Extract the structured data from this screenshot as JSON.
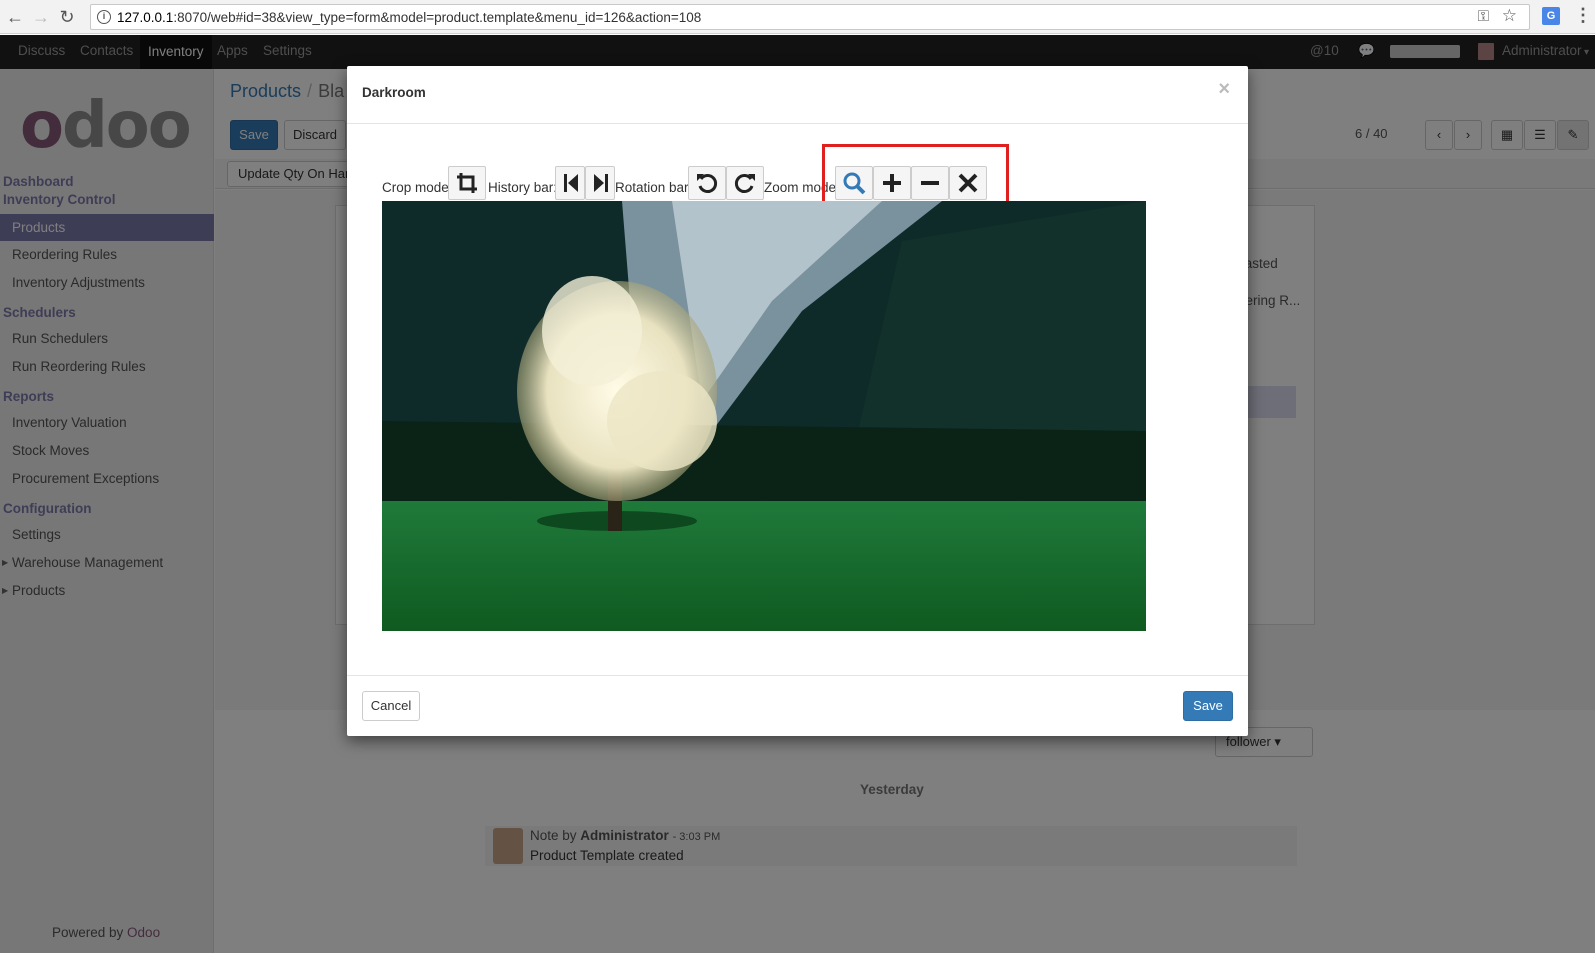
{
  "browser": {
    "url_host": "127.0.0.1",
    "url_rest": ":8070/web#id=38&view_type=form&model=product.template&menu_id=126&action=108"
  },
  "topbar": {
    "apps": [
      "Discuss",
      "Contacts",
      "Inventory",
      "Apps",
      "Settings"
    ],
    "active_app": "Inventory",
    "mentions": "@10",
    "user": "Administrator"
  },
  "sidebar": {
    "sections": [
      {
        "label": "Dashboard"
      },
      {
        "label": "Inventory Control",
        "items": [
          "Products",
          "Reordering Rules",
          "Inventory Adjustments"
        ]
      },
      {
        "label": "Schedulers",
        "items": [
          "Run Schedulers",
          "Run Reordering Rules"
        ]
      },
      {
        "label": "Reports",
        "items": [
          "Inventory Valuation",
          "Stock Moves",
          "Procurement Exceptions"
        ]
      },
      {
        "label": "Configuration",
        "items": [
          "Settings",
          "Warehouse Management",
          "Products"
        ]
      }
    ],
    "powered_prefix": "Powered by ",
    "powered_brand": "Odoo"
  },
  "main": {
    "breadcrumb_root": "Products",
    "breadcrumb_current": "Bla",
    "save": "Save",
    "discard": "Discard",
    "pager": "6 / 40",
    "update_qty": "Update Qty On Han",
    "forecasted": "recasted",
    "reordering": "ordering R...",
    "follower": "follower",
    "yesterday": "Yesterday",
    "note_prefix": "Note by",
    "note_author": "Administrator",
    "note_time": "- 3:03 PM",
    "note_body": "Product Template created"
  },
  "modal": {
    "title": "Darkroom",
    "close": "×",
    "toolbar": {
      "crop_label": "Crop mode:",
      "history_label": "History bar:",
      "rotation_label": "Rotation bar:",
      "zoom_label": "Zoom mode:"
    },
    "cancel": "Cancel",
    "save": "Save"
  },
  "colors": {
    "brand": "#875a7b",
    "primary": "#337ab7",
    "sidebar_accent": "#7c7bad",
    "highlight": "#e0201f"
  }
}
